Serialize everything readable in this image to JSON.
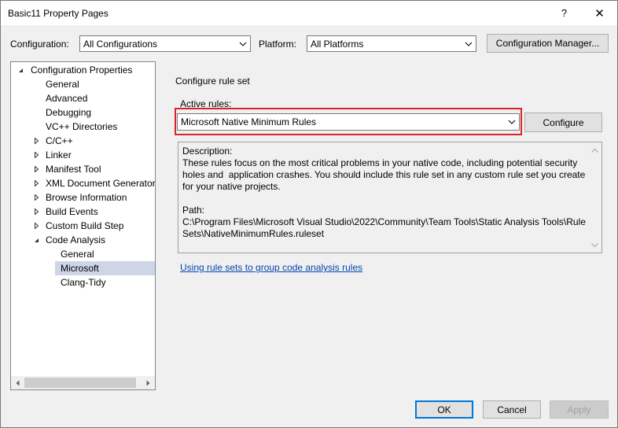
{
  "window": {
    "title": "Basic11 Property Pages",
    "help_glyph": "?",
    "close_glyph": "✕"
  },
  "toolbar": {
    "configuration_label": "Configuration:",
    "configuration_value": "All Configurations",
    "platform_label": "Platform:",
    "platform_value": "All Platforms",
    "config_manager_label": "Configuration Manager..."
  },
  "tree": {
    "root": "Configuration Properties",
    "items": [
      {
        "label": "General"
      },
      {
        "label": "Advanced"
      },
      {
        "label": "Debugging"
      },
      {
        "label": "VC++ Directories"
      },
      {
        "label": "C/C++"
      },
      {
        "label": "Linker"
      },
      {
        "label": "Manifest Tool"
      },
      {
        "label": "XML Document Generator"
      },
      {
        "label": "Browse Information"
      },
      {
        "label": "Build Events"
      },
      {
        "label": "Custom Build Step"
      },
      {
        "label": "Code Analysis"
      }
    ],
    "code_analysis_children": [
      {
        "label": "General"
      },
      {
        "label": "Microsoft",
        "selected": true
      },
      {
        "label": "Clang-Tidy"
      }
    ]
  },
  "main": {
    "section_title": "Configure rule set",
    "active_rules_label": "Active rules:",
    "active_rules_value": "Microsoft Native Minimum Rules",
    "configure_button": "Configure",
    "description_text": "Description:\nThese rules focus on the most critical problems in your native code, including potential security holes and  application crashes. You should include this rule set in any custom rule set you create for your native projects.\n\nPath:\nC:\\Program Files\\Microsoft Visual Studio\\2022\\Community\\Team Tools\\Static Analysis Tools\\Rule Sets\\NativeMinimumRules.ruleset",
    "link_text": "Using rule sets to group code analysis rules"
  },
  "footer": {
    "ok": "OK",
    "cancel": "Cancel",
    "apply": "Apply"
  },
  "colors": {
    "highlight_border": "#d9232d",
    "selection": "#cdd5e6",
    "link": "#0645ad",
    "ok_border": "#0078d7"
  }
}
